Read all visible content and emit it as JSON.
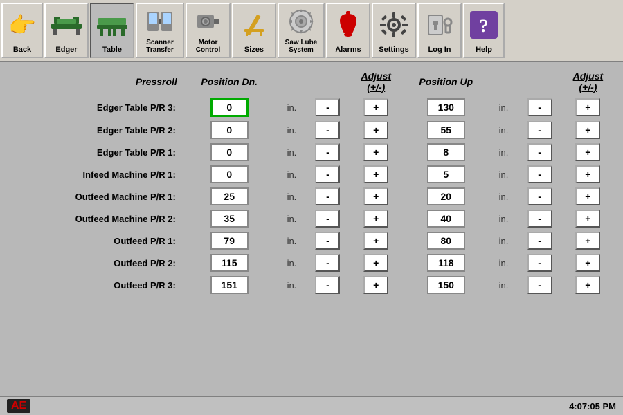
{
  "toolbar": {
    "buttons": [
      {
        "id": "back",
        "label": "Back",
        "icon": "hand"
      },
      {
        "id": "edger",
        "label": "Edger",
        "icon": "edger"
      },
      {
        "id": "table",
        "label": "Table",
        "icon": "table"
      },
      {
        "id": "scanner-transfer",
        "label": "Scanner\nTransfer",
        "icon": "scanner"
      },
      {
        "id": "motor-control",
        "label": "Motor\nControl",
        "icon": "motor"
      },
      {
        "id": "sizes",
        "label": "Sizes",
        "icon": "sizes"
      },
      {
        "id": "saw-lube",
        "label": "Saw Lube\nSystem",
        "icon": "saw"
      },
      {
        "id": "alarms",
        "label": "Alarms",
        "icon": "alarms"
      },
      {
        "id": "settings",
        "label": "Settings",
        "icon": "settings"
      },
      {
        "id": "login",
        "label": "Log In",
        "icon": "login"
      },
      {
        "id": "help",
        "label": "Help",
        "icon": "help"
      }
    ]
  },
  "table": {
    "headers": {
      "pressroll": "Pressroll",
      "position_dn": "Position Dn.",
      "adjust_dn": "Adjust (+/-)",
      "position_up": "Position Up",
      "adjust_up": "Adjust (+/-)"
    },
    "rows": [
      {
        "label": "Edger Table P/R 3:",
        "pos_dn": "0",
        "pos_up": "130",
        "highlighted": true
      },
      {
        "label": "Edger Table P/R 2:",
        "pos_dn": "0",
        "pos_up": "55",
        "highlighted": false
      },
      {
        "label": "Edger Table P/R 1:",
        "pos_dn": "0",
        "pos_up": "8",
        "highlighted": false
      },
      {
        "label": "Infeed Machine P/R 1:",
        "pos_dn": "0",
        "pos_up": "5",
        "highlighted": false
      },
      {
        "label": "Outfeed Machine P/R 1:",
        "pos_dn": "25",
        "pos_up": "20",
        "highlighted": false
      },
      {
        "label": "Outfeed Machine P/R 2:",
        "pos_dn": "35",
        "pos_up": "40",
        "highlighted": false
      },
      {
        "label": "Outfeed P/R 1:",
        "pos_dn": "79",
        "pos_up": "80",
        "highlighted": false
      },
      {
        "label": "Outfeed P/R 2:",
        "pos_dn": "115",
        "pos_up": "118",
        "highlighted": false
      },
      {
        "label": "Outfeed P/R 3:",
        "pos_dn": "151",
        "pos_up": "150",
        "highlighted": false
      }
    ],
    "unit": "in.",
    "minus_label": "-",
    "plus_label": "+"
  },
  "statusbar": {
    "logo": "AE",
    "time": "4:07:05 PM"
  }
}
